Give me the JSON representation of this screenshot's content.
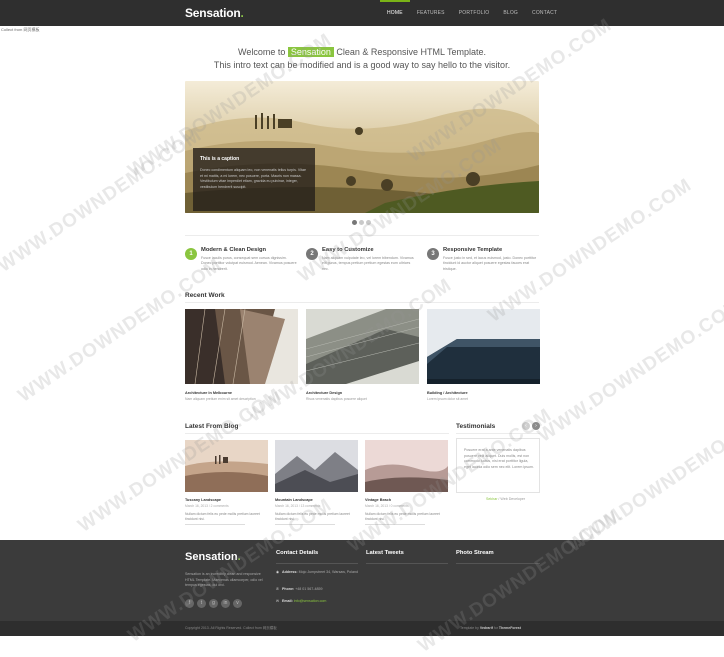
{
  "header": {
    "brand": "Sensation",
    "brand_dot": ".",
    "nav": [
      "HOME",
      "FEATURES",
      "PORTFOLIO",
      "BLOG",
      "CONTACT"
    ]
  },
  "collect_note": "Collect from 网页模板",
  "intro": {
    "line1_before": "Welcome to ",
    "highlight": "Sensation",
    "line1_after": " Clean & Responsive HTML Template.",
    "line2": "This intro text can be modified and is a good way to say hello to the visitor."
  },
  "slider": {
    "caption_title": "This is a caption",
    "caption_text": "Donec condimentum aliquam leo, non venenatis tellus turpis. Vitae et mi mattis, a mi lorem, nec posuere, porta. Mauris non massa. Vestibulum vitae imperdiet etiam, gravida eu pulvinar, integer, vestibulum hendrerit suscipit.",
    "dots": 3,
    "active_dot": 1
  },
  "features": [
    {
      "num": "1",
      "title": "Modern & Clean Design",
      "text": "Fusce iaculis purus, consequat sem cursus dignissim. Donec porttitor volutpat euismod. Aenean. Vivamus posuere odio in hendrerit."
    },
    {
      "num": "2",
      "title": "Easy to Customize",
      "text": "Nam aliquam vulputate leo, vel lorem bibendum. Vivamus elit purus, tempus pretium pretium egestas eum ultrices nec."
    },
    {
      "num": "3",
      "title": "Responsive Template",
      "text": "Fusce justo in sed, et lacus euismod, justo. Donec porttitor tincidunt id auctor aliquet posuere egestas fauces erat tristique."
    }
  ],
  "recent_work": {
    "heading": "Recent Work",
    "items": [
      {
        "title": "Architecture In Melbourne",
        "desc": "Nam aliquam pretium enim sit amet description"
      },
      {
        "title": "Architecture Design",
        "desc": "Risus venenatis dapibus posuere aliquet"
      },
      {
        "title": "Building / Architecture",
        "desc": "Lorem ipsum dolor sit amet"
      }
    ]
  },
  "blog": {
    "heading": "Latest From Blog",
    "posts": [
      {
        "title": "Tuscany Landscape",
        "meta": "March 16, 2013 / 2 comments",
        "text": "Nullam dictum felis eu pede mollis pretium laoreet tincidunt nisi."
      },
      {
        "title": "Mountain Landscape",
        "meta": "March 16, 2013 / 13 comments",
        "text": "Nullam dictum felis eu pede mollis pretium laoreet tincidunt nisi."
      },
      {
        "title": "Vintage Beach",
        "meta": "March 16, 2013 / 0 comments",
        "text": "Nullam dictum felis eu pede mollis pretium laoreet tincidunt nisi."
      }
    ]
  },
  "testimonials": {
    "heading": "Testimonials",
    "prev": "‹",
    "next": "›",
    "quote": "Posuere erat a ante venenatis dapibus posuere velit aliquet. Duis mollis, est non commodo luctus, nisi erat porttitor ligula, eget lacinia odio sem nec elit. Lorem ipsum.",
    "author": "Sekhar",
    "role": "/ Web Developer"
  },
  "footer": {
    "brand": "Sensation",
    "brand_dot": ".",
    "desc": "Sensation is an incredibly clean and responsive HTML Template. Maecenas ullamcorper, odio vel tempus egestas, dui orci.",
    "socials": [
      "f",
      "t",
      "g",
      "in",
      "v"
    ],
    "contact_heading": "Contact Details",
    "address_label": "Address:",
    "address": "Mojo Jumpstreet 34, Warsaw, Poland",
    "phone_label": "Phone:",
    "phone": "+48 01 567-4859",
    "email_label": "Email:",
    "email": "info@sensation.com",
    "tweets_heading": "Latest Tweets",
    "photo_heading": "Photo Stream",
    "copyright": "Copyright 2013. All Rights Reserved. Collect from 网页模板",
    "credit_before": "Template by ",
    "credit_author": "Vedrarif",
    "credit_mid": " for ",
    "credit_site": "ThemeForest"
  },
  "watermark": "WWW.DOWNDEMO.COM",
  "colors": {
    "accent": "#8ac53f",
    "header_bg": "#2f2f2f",
    "footer_bg": "#3b3b3b"
  }
}
